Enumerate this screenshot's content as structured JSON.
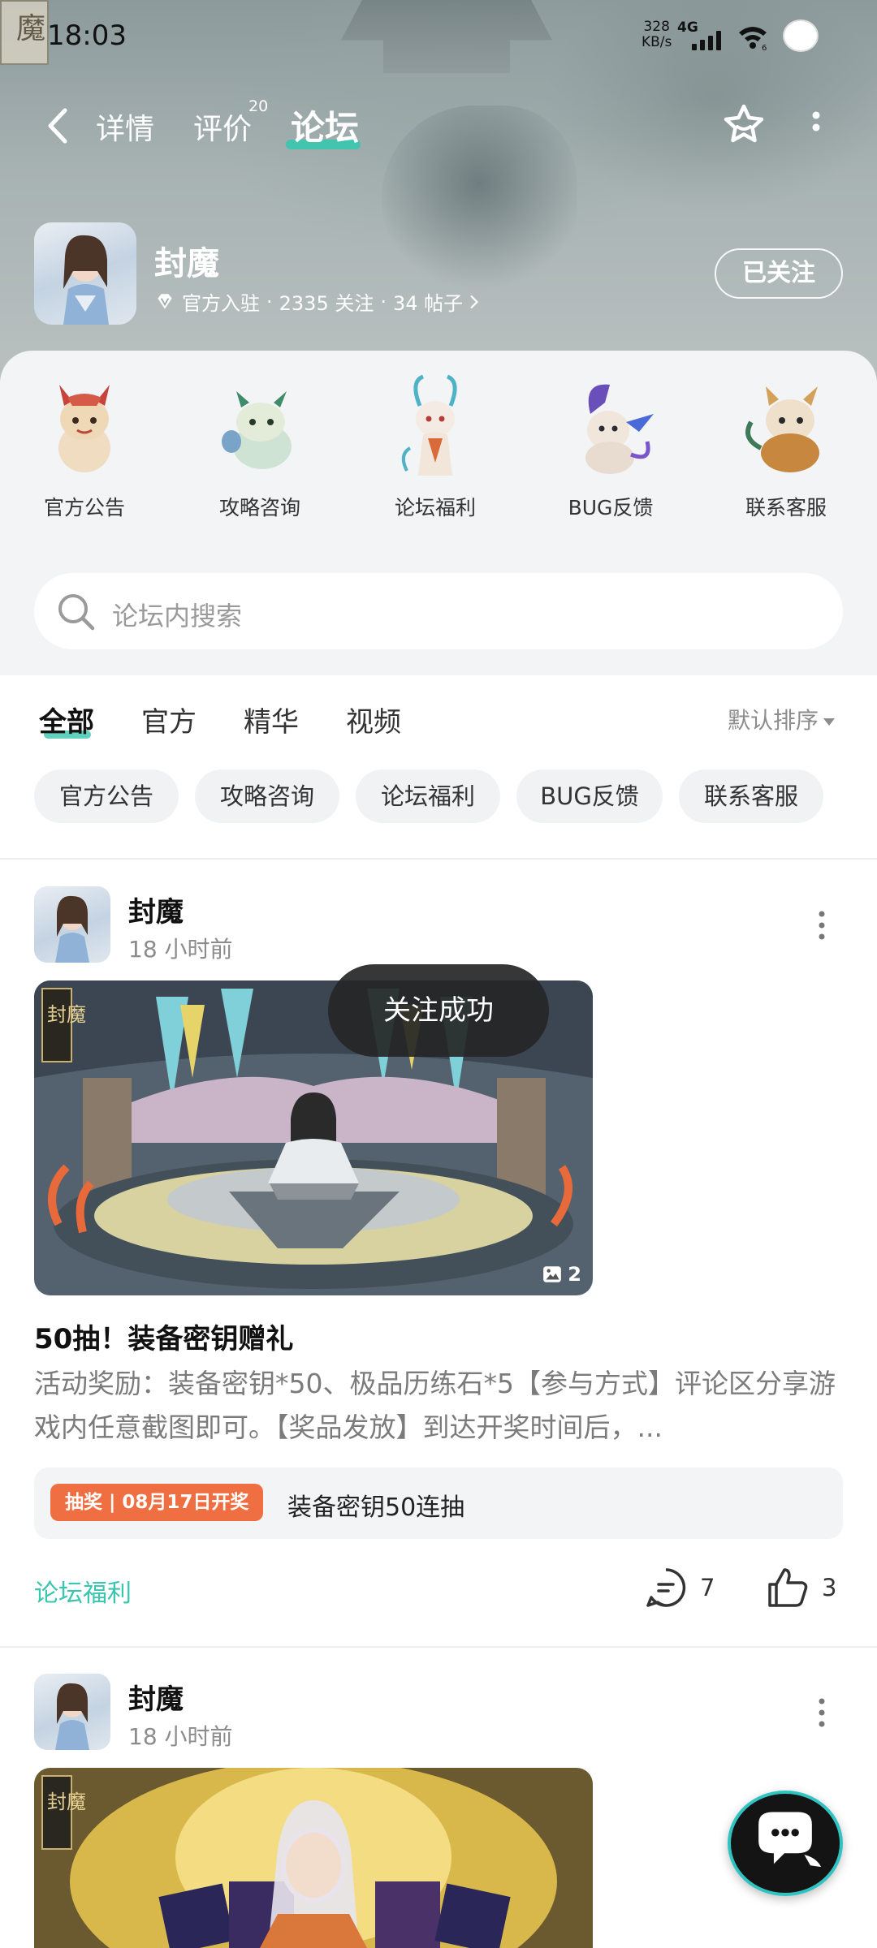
{
  "status_bar": {
    "time": "18:03",
    "net_speed_value": "328",
    "net_speed_unit": "KB/s",
    "network": "4G",
    "wifi_badge": "6"
  },
  "nav": {
    "tabs": [
      {
        "label": "详情"
      },
      {
        "label": "评价",
        "badge": "20"
      },
      {
        "label": "论坛"
      }
    ],
    "active_tab": "论坛"
  },
  "game": {
    "name": "封魔",
    "official": "官方入驻",
    "followers": "2335 关注",
    "posts": "34 帖子",
    "separator": "·",
    "follow_label": "已关注",
    "banner_char": "魔"
  },
  "categories": [
    {
      "label": "官方公告",
      "icon": "dragon-red-icon"
    },
    {
      "label": "攻略咨询",
      "icon": "dragon-green-icon"
    },
    {
      "label": "论坛福利",
      "icon": "dragon-white-icon"
    },
    {
      "label": "BUG反馈",
      "icon": "dragon-purple-icon"
    },
    {
      "label": "联系客服",
      "icon": "dragon-orange-icon"
    }
  ],
  "search": {
    "placeholder": "论坛内搜索"
  },
  "feed_tabs": [
    {
      "label": "全部"
    },
    {
      "label": "官方"
    },
    {
      "label": "精华"
    },
    {
      "label": "视频"
    }
  ],
  "sort_label": "默认排序",
  "filter_chips": [
    {
      "label": "官方公告"
    },
    {
      "label": "攻略咨询"
    },
    {
      "label": "论坛福利"
    },
    {
      "label": "BUG反馈"
    },
    {
      "label": "联系客服"
    }
  ],
  "posts": [
    {
      "author": "封魔",
      "time": "18 小时前",
      "image_count": "2",
      "image_seal": "封魔",
      "title": "50抽！装备密钥赠礼",
      "body": "活动奖励：装备密钥*50、极品历练石*5【参与方式】评论区分享游戏内任意截图即可。【奖品发放】到达开奖时间后，...",
      "lottery_tag": "抽奖 | 08月17日开奖",
      "lottery_text": "装备密钥50连抽",
      "category": "论坛福利",
      "comments": "7",
      "likes": "3"
    },
    {
      "author": "封魔",
      "time": "18 小时前",
      "image_seal": "封魔"
    }
  ],
  "toast": "关注成功",
  "colors": {
    "accent": "#39c6ae",
    "lottery": "#ef6f42",
    "chip_bg": "#f1f2f4"
  }
}
